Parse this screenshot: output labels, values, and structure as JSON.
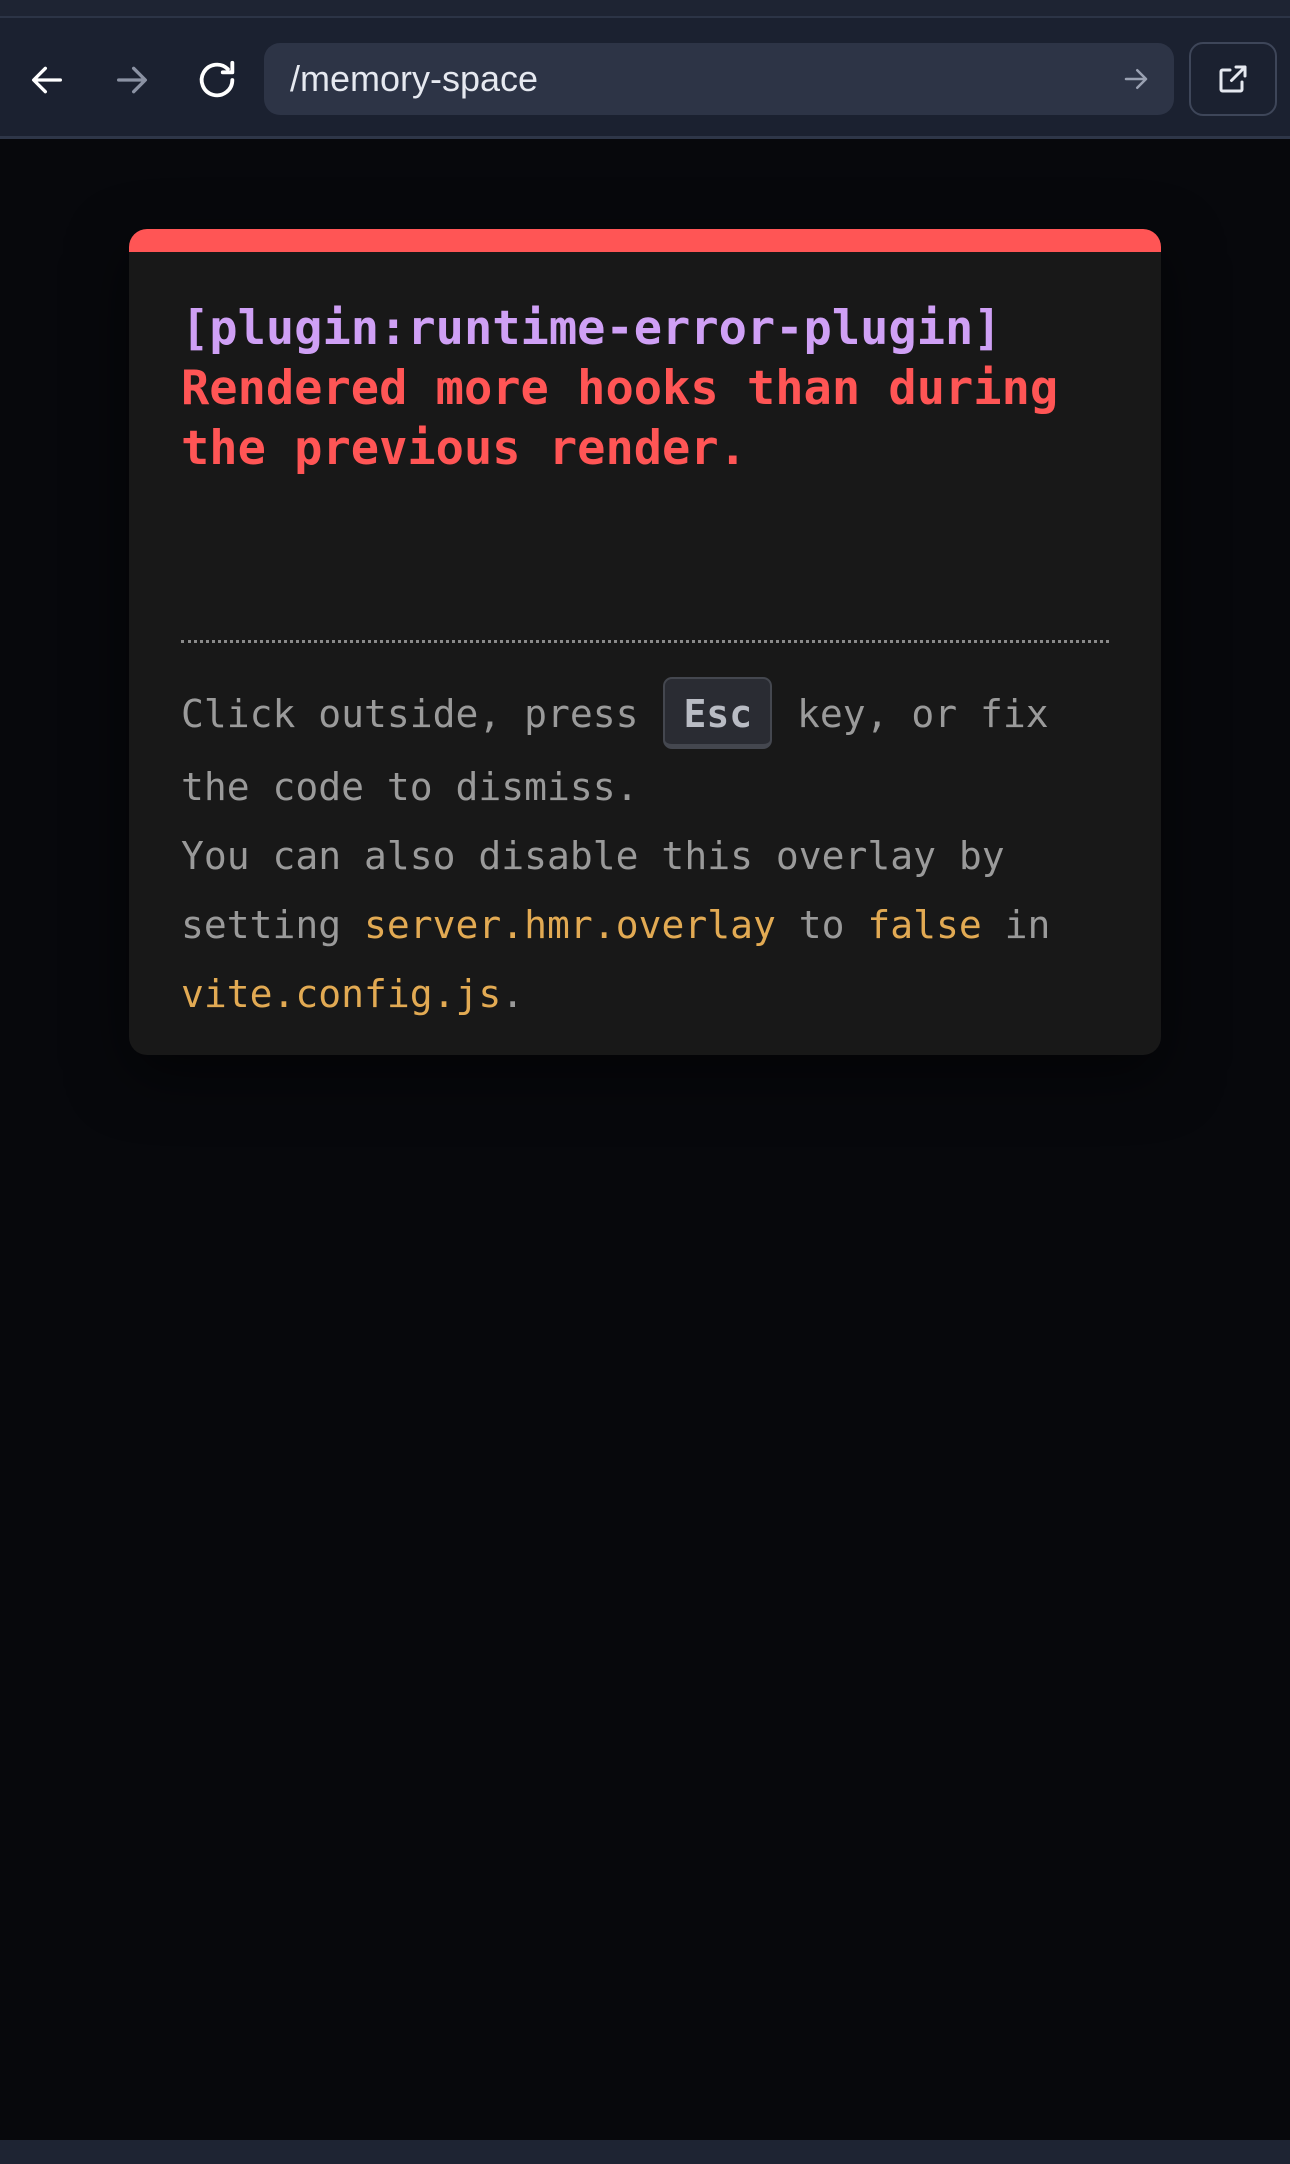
{
  "browser": {
    "url": "/memory-space",
    "icons": {
      "back": "arrow-left-icon",
      "forward": "arrow-right-icon",
      "reload": "reload-icon",
      "go": "arrow-right-icon",
      "external": "external-link-icon"
    }
  },
  "overlay": {
    "plugin": "[plugin:runtime-error-plugin]",
    "message": "Rendered more hooks than during the previous render.",
    "tip": {
      "line1_before": "Click outside, press ",
      "key": "Esc",
      "line1_after": " key, or fix the code to dismiss.",
      "line2_before": "You can also disable this overlay by setting ",
      "config_key": "server.hmr.overlay",
      "middle": " to ",
      "config_value": "false",
      "in_text": " in ",
      "config_file": "vite.config.js",
      "period": "."
    }
  },
  "colors": {
    "accent_red": "#ff5555",
    "plugin_purple": "#cfa0f5",
    "code_orange": "#e2aa53",
    "background": "#07080c"
  }
}
